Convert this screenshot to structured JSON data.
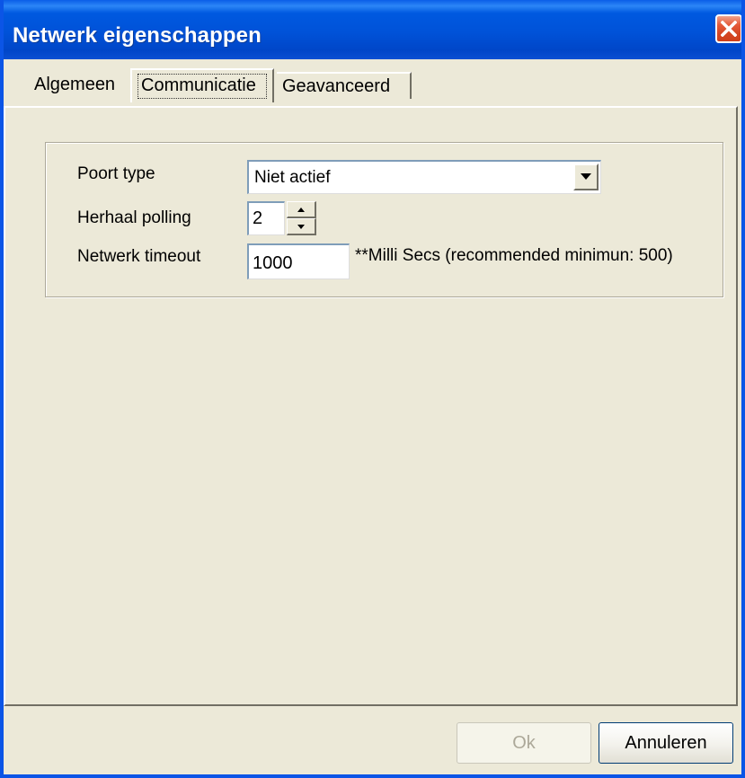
{
  "window": {
    "title": "Netwerk eigenschappen"
  },
  "tabs": [
    {
      "label": "Algemeen",
      "active": false
    },
    {
      "label": "Communicatie",
      "active": true
    },
    {
      "label": "Geavanceerd",
      "active": false
    }
  ],
  "form": {
    "port_type": {
      "label": "Poort type",
      "value": "Niet actief"
    },
    "repeat_polling": {
      "label": "Herhaal polling",
      "value": "2"
    },
    "network_timeout": {
      "label": "Netwerk timeout",
      "value": "1000",
      "note": "**Milli Secs (recommended minimun: 500)"
    }
  },
  "buttons": {
    "ok_label": "Ok",
    "cancel_label": "Annuleren"
  },
  "colors": {
    "title_bar": "#0052d8",
    "close_button": "#d44623",
    "dialog_background": "#ece9d8",
    "disabled_text": "#aca899"
  },
  "icons": {
    "close": "close-icon",
    "dropdown": "chevron-down-icon",
    "spin_up": "spin-up-icon",
    "spin_down": "spin-down-icon"
  }
}
